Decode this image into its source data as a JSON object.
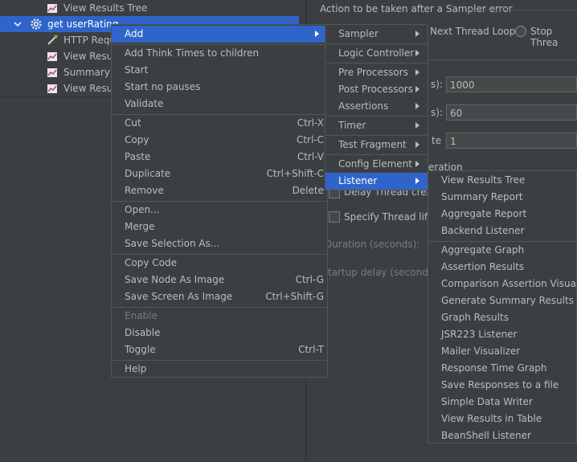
{
  "tree": {
    "items": [
      {
        "label": "View Results Tree"
      },
      {
        "label": "get userRating"
      },
      {
        "label": "HTTP Requ"
      },
      {
        "label": "View Result"
      },
      {
        "label": "Summary R"
      },
      {
        "label": "View Result"
      }
    ]
  },
  "form": {
    "error_title": "Action to be taken after a Sampler error",
    "next_thread_loop": "Next Thread Loop",
    "stop_thread": "Stop Threa",
    "threads_suffix": "s):",
    "threads_value": "1000",
    "rampup_suffix": "s):",
    "rampup_value": "60",
    "loop_suffix": "te",
    "loop_value": "1",
    "iteration_label": "eration",
    "delay_thread": "Delay Thread creatio",
    "specify_lifetime": "Specify Thread lifeti",
    "duration_label": "Duration (seconds):",
    "startup_label": "tartup delay (seconds):"
  },
  "context_menu": {
    "add": "Add",
    "add_think_times": "Add Think Times to children",
    "start": "Start",
    "start_no_pauses": "Start no pauses",
    "validate": "Validate",
    "cut": "Cut",
    "cut_sc": "Ctrl-X",
    "copy": "Copy",
    "copy_sc": "Ctrl-C",
    "paste": "Paste",
    "paste_sc": "Ctrl-V",
    "duplicate": "Duplicate",
    "duplicate_sc": "Ctrl+Shift-C",
    "remove": "Remove",
    "remove_sc": "Delete",
    "open": "Open...",
    "merge": "Merge",
    "save_selection": "Save Selection As...",
    "copy_code": "Copy Code",
    "save_node_image": "Save Node As Image",
    "save_node_image_sc": "Ctrl-G",
    "save_screen_image": "Save Screen As Image",
    "save_screen_image_sc": "Ctrl+Shift-G",
    "enable": "Enable",
    "disable": "Disable",
    "toggle": "Toggle",
    "toggle_sc": "Ctrl-T",
    "help": "Help"
  },
  "add_menu": {
    "sampler": "Sampler",
    "logic_controller": "Logic Controller",
    "pre_processors": "Pre Processors",
    "post_processors": "Post Processors",
    "assertions": "Assertions",
    "timer": "Timer",
    "test_fragment": "Test Fragment",
    "config_element": "Config Element",
    "listener": "Listener"
  },
  "listener_menu": {
    "items_a": [
      "View Results Tree",
      "Summary Report",
      "Aggregate Report",
      "Backend Listener"
    ],
    "items_b": [
      "Aggregate Graph",
      "Assertion Results",
      "Comparison Assertion Visualizer",
      "Generate Summary Results",
      "Graph Results",
      "JSR223 Listener",
      "Mailer Visualizer",
      "Response Time Graph",
      "Save Responses to a file",
      "Simple Data Writer",
      "View Results in Table",
      "BeanShell Listener"
    ]
  },
  "colors": {
    "background": "#3c3f41",
    "selection": "#2f65ca",
    "text": "#bbbbbb",
    "disabled_text": "#7b7b7b"
  }
}
